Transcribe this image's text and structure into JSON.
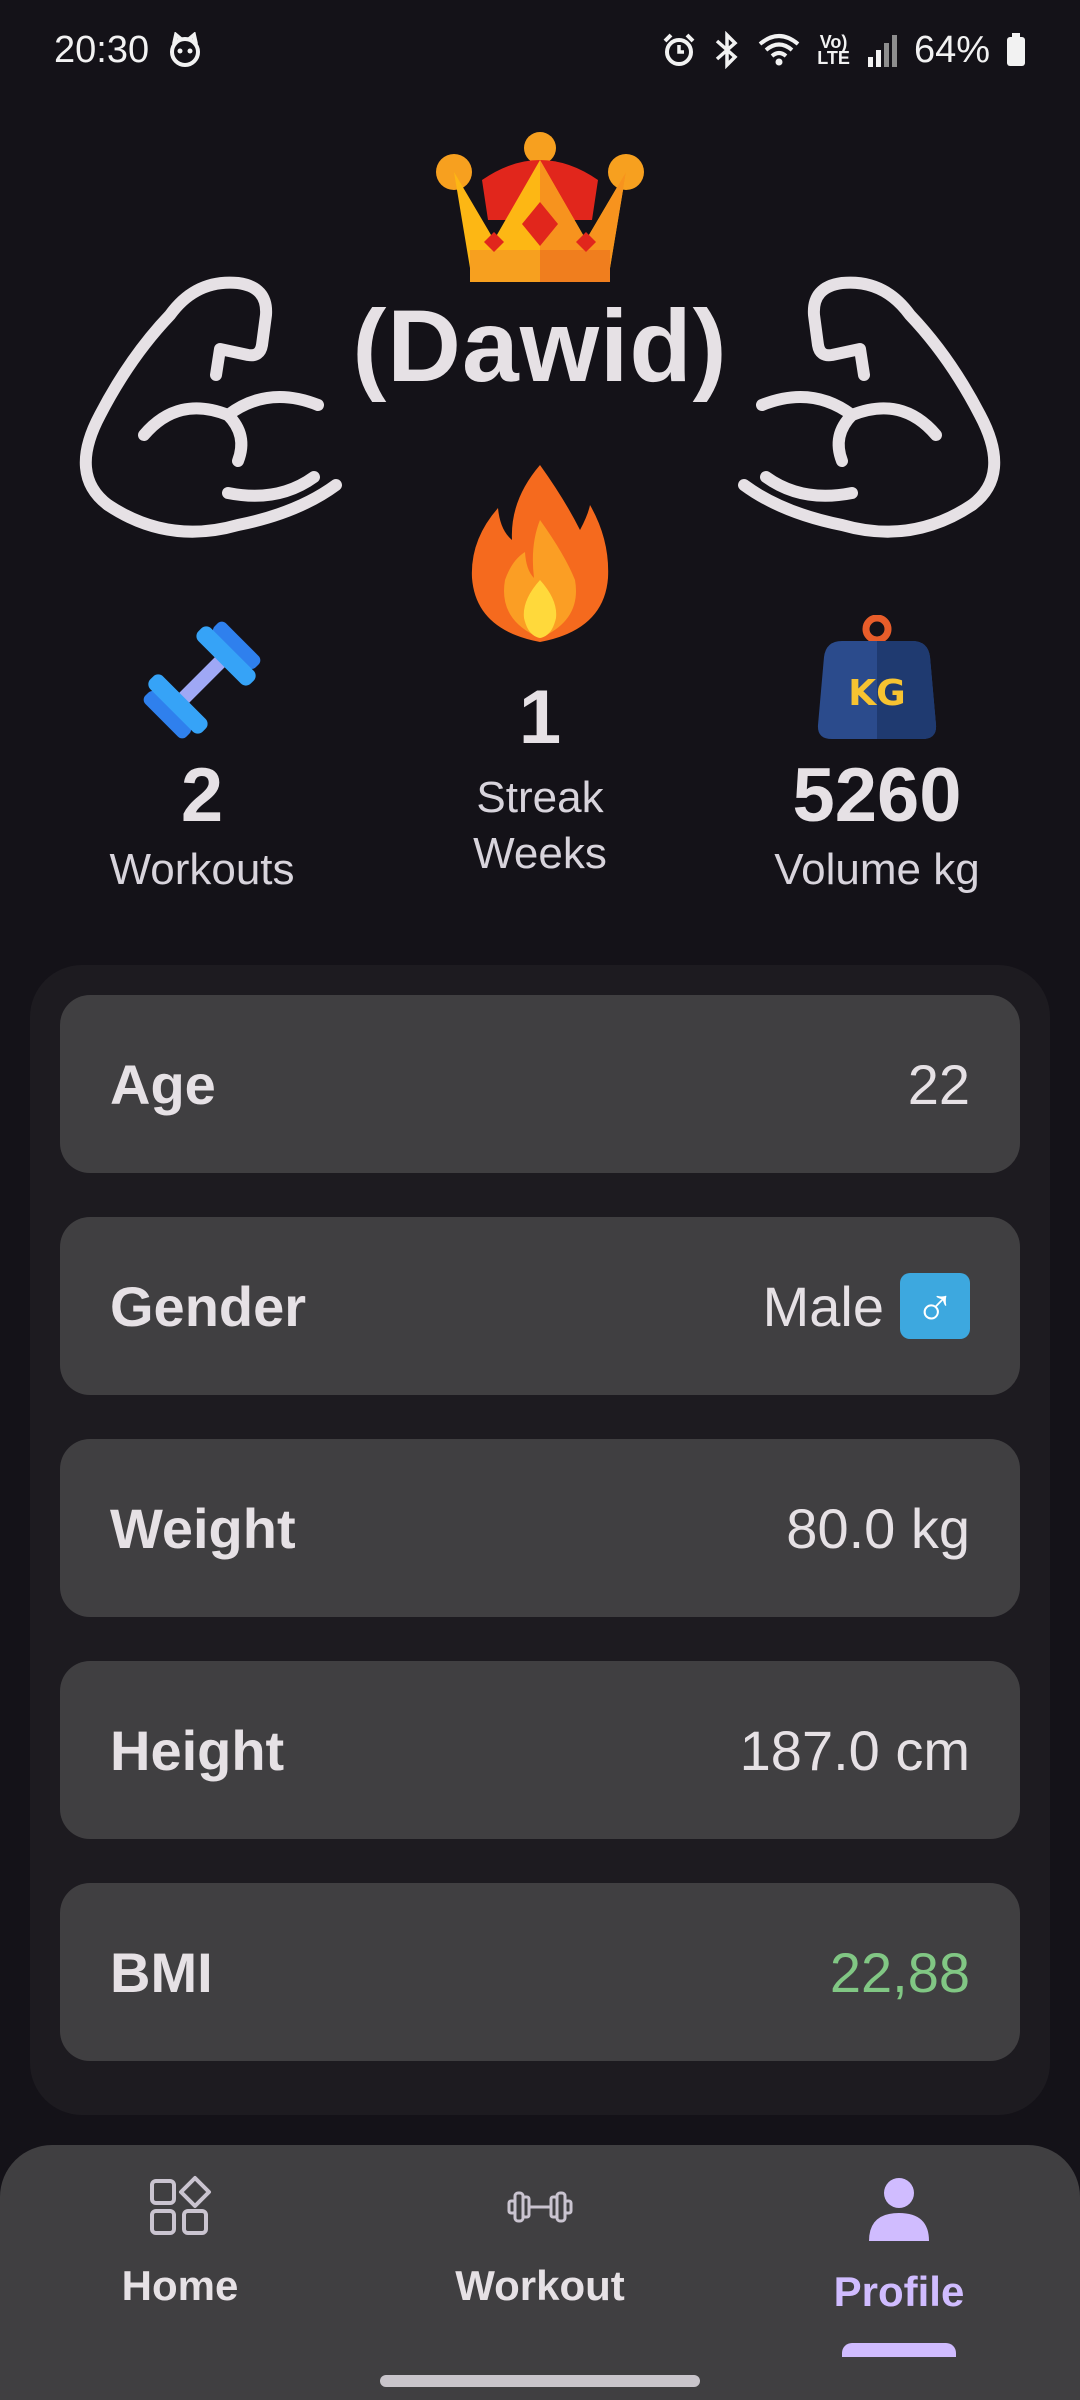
{
  "status_bar": {
    "time": "20:30",
    "lte_label_top": "Vo)",
    "lte_label_bottom": "LTE",
    "battery": "64%",
    "icons": [
      "cat-face-icon",
      "alarm-icon",
      "bluetooth-icon",
      "wifi-icon",
      "signal-icon",
      "battery-icon"
    ]
  },
  "header": {
    "user_name": "(Dawid)",
    "icons": [
      "crown-icon",
      "flexed-arm-icon"
    ]
  },
  "stats": {
    "workouts": {
      "value": "2",
      "label": "Workouts",
      "icon": "dumbbell-icon"
    },
    "streak": {
      "value": "1",
      "label_line1": "Streak",
      "label_line2": "Weeks",
      "icon": "fire-icon"
    },
    "volume": {
      "value": "5260",
      "label": "Volume kg",
      "icon": "kg-weight-icon",
      "icon_text": "KG"
    }
  },
  "profile": {
    "age": {
      "label": "Age",
      "value": "22"
    },
    "gender": {
      "label": "Gender",
      "value": "Male",
      "icon": "male-sign-icon",
      "icon_text": "♂"
    },
    "weight": {
      "label": "Weight",
      "value": "80.0 kg"
    },
    "height": {
      "label": "Height",
      "value": "187.0 cm"
    },
    "bmi": {
      "label": "BMI",
      "value": "22,88",
      "value_color": "#81C784"
    }
  },
  "nav": {
    "home": "Home",
    "workout": "Workout",
    "profile": "Profile",
    "active": "profile",
    "accent": "#D0BCFF"
  }
}
